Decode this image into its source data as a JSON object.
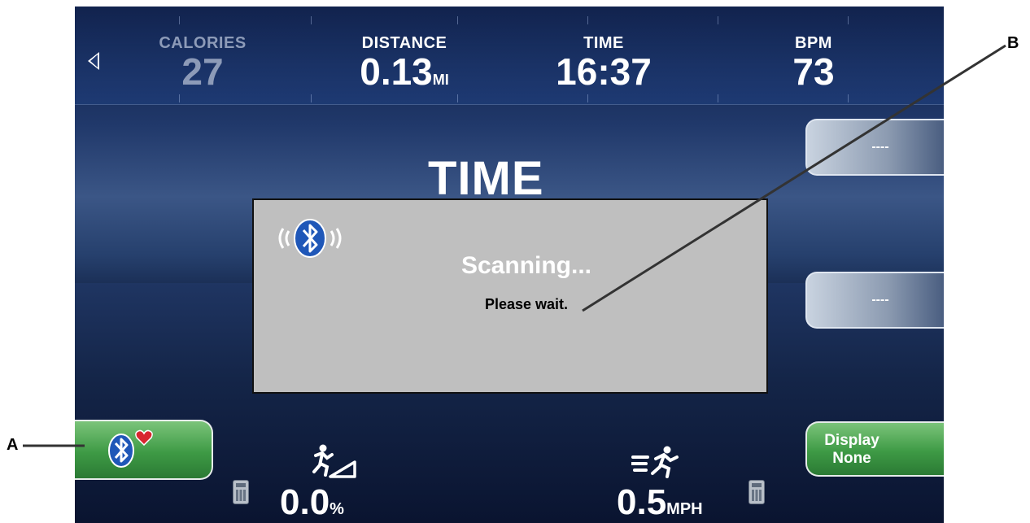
{
  "callouts": {
    "a": "A",
    "b": "B"
  },
  "topbar": {
    "stats": [
      {
        "label": "CALORIES",
        "value": "27",
        "unit": ""
      },
      {
        "label": "DISTANCE",
        "value": "0.13",
        "unit": "MI"
      },
      {
        "label": "TIME",
        "value": "16:37",
        "unit": ""
      },
      {
        "label": "BPM",
        "value": "73",
        "unit": ""
      }
    ]
  },
  "main": {
    "title": "TIME"
  },
  "side_buttons": {
    "upper": "----",
    "lower": "----"
  },
  "dialog": {
    "title": "Scanning...",
    "message": "Please wait."
  },
  "bottom": {
    "display_button": {
      "line1": "Display",
      "line2": "None"
    },
    "incline": {
      "value": "0.0",
      "unit": "%"
    },
    "speed": {
      "value": "0.5",
      "unit": "MPH"
    }
  },
  "colors": {
    "accent_green": "#3e9a45",
    "bluetooth_blue": "#1f57b8",
    "heart_red": "#d8262f",
    "dialog_gray": "#bfbfbf"
  },
  "icons": [
    "back-arrow-icon",
    "bluetooth-icon",
    "heart-icon",
    "incline-runner-icon",
    "speed-runner-icon",
    "keypad-icon"
  ]
}
